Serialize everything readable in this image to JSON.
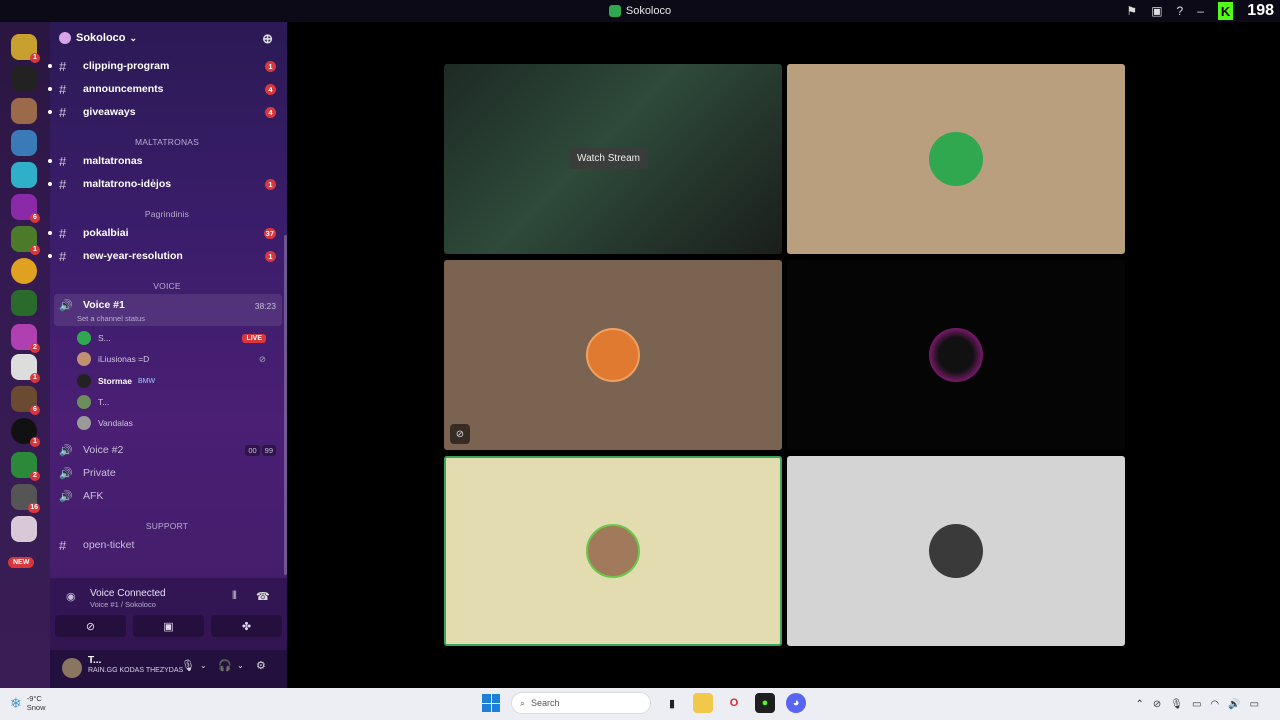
{
  "window": {
    "title": "Sokoloco",
    "count": "198",
    "k_badge": "K"
  },
  "server": {
    "name": "Sokoloco"
  },
  "channels": {
    "clipping": {
      "label": "clipping-program",
      "badge": "1"
    },
    "announcements": {
      "label": "announcements",
      "badge": "4"
    },
    "giveaways": {
      "label": "giveaways",
      "badge": "4"
    },
    "cat_maltatronas": "MALTATRONAS",
    "maltatronas": {
      "label": "maltatronas"
    },
    "ideajos": {
      "label": "maltatrono-idėjos",
      "badge": "1"
    },
    "cat_pagrindinis": "Pagrindinis",
    "pokalbiai": {
      "label": "pokalbiai",
      "badge": "37"
    },
    "newyear": {
      "label": "new-year-resolution",
      "badge": "1"
    },
    "cat_voice": "VOICE",
    "voice1": {
      "label": "Voice #1",
      "time": "38:23",
      "status": "Set a channel status"
    },
    "voice2": {
      "label": "Voice #2",
      "count_a": "00",
      "count_b": "99"
    },
    "private": {
      "label": "Private"
    },
    "afk": {
      "label": "AFK"
    },
    "cat_support": "SUPPORT",
    "openticket": {
      "label": "open-ticket"
    }
  },
  "members": [
    {
      "name": "S...",
      "badge": "LIVE"
    },
    {
      "name": "iLiusionas =D"
    },
    {
      "name": "Stormae",
      "tag": "BMW"
    },
    {
      "name": "T..."
    },
    {
      "name": "Vandalas"
    }
  ],
  "guild_new": "NEW",
  "voice_panel": {
    "title": "Voice Connected",
    "sub": "Voice #1 / Sokoloco"
  },
  "user": {
    "name": "T...",
    "status": "RAIN.GG KODAS THEZYDAS"
  },
  "stage": {
    "watch_label": "Watch Stream"
  },
  "taskbar": {
    "temp": "-9°C",
    "weather": "Snow",
    "search_placeholder": "Search"
  },
  "colors": {
    "live": "#da373c",
    "speaking": "#3ba55c",
    "tile_tan": "#b99f7e",
    "tile_brown": "#7a6350",
    "tile_cream": "#e2dcb0",
    "tile_grey": "#d4d4d4"
  }
}
